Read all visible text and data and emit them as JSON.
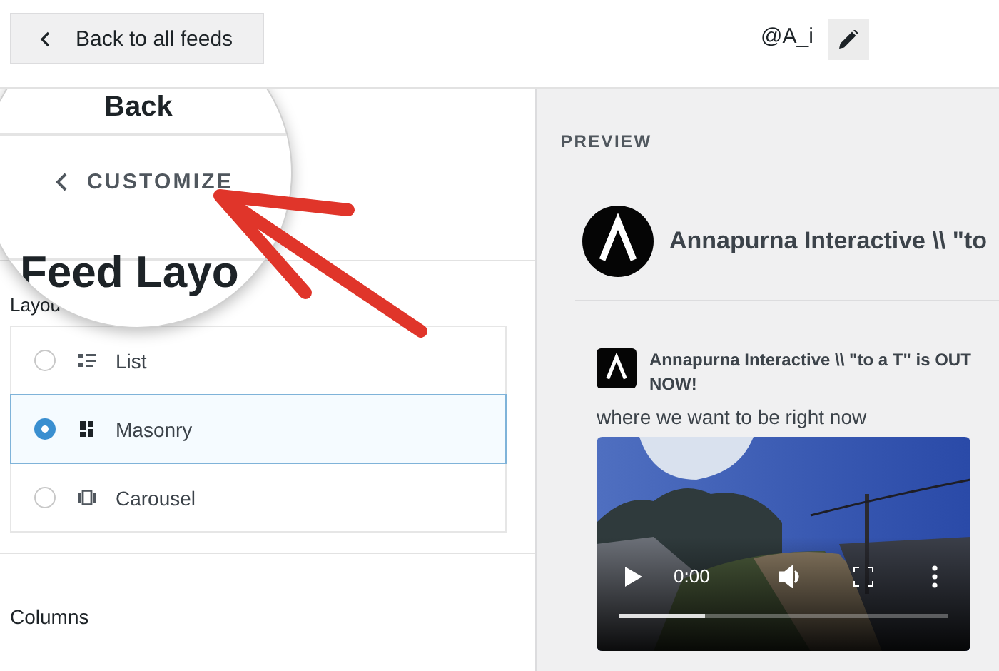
{
  "top_bar": {
    "back_button": "Back to all feeds",
    "handle": "@A_i"
  },
  "magnifier": {
    "back_fragment": "Back",
    "customize": "CUSTOMIZE",
    "heading_fragment": "Feed Layo"
  },
  "layout_label": "Layou",
  "layout_options": [
    {
      "label": "List",
      "kind": "list",
      "selected": false
    },
    {
      "label": "Masonry",
      "kind": "masonry",
      "selected": true
    },
    {
      "label": "Carousel",
      "kind": "carousel",
      "selected": false
    }
  ],
  "columns_label": "Columns",
  "preview": {
    "title": "PREVIEW",
    "feed_name": "Annapurna Interactive \\\\ \"to",
    "post": {
      "title": "Annapurna Interactive \\\\ \"to a T\" is OUT NOW!",
      "caption": "where we want to be right now",
      "video": {
        "time": "0:00",
        "level": 0.26
      }
    }
  }
}
